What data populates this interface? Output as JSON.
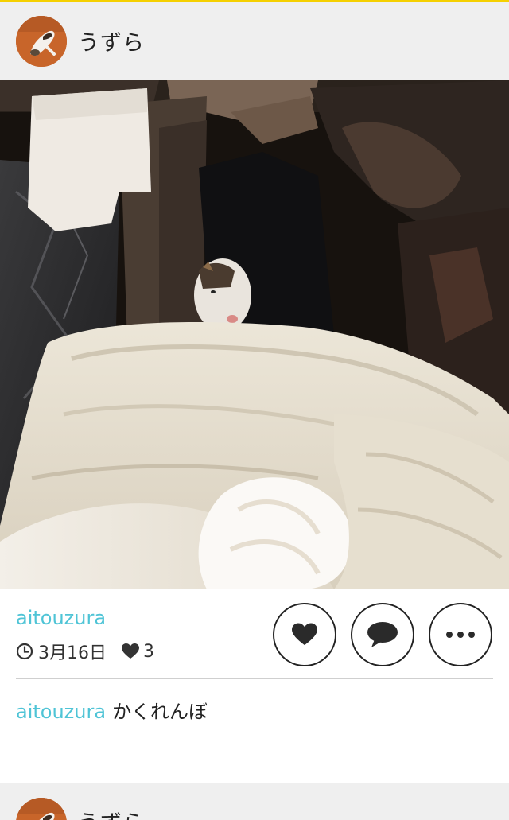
{
  "colors": {
    "accent": "#4fc4d6",
    "top_line": "#f5d000",
    "card_bg": "#ffffff",
    "page_bg": "#efefef"
  },
  "post": {
    "header": {
      "title": "うずら",
      "avatar_icon": "cat-avatar"
    },
    "photo": {
      "icon": "cat-hiding-in-closet-photo"
    },
    "username": "aitouzura",
    "date": "3月16日",
    "like_count": "3",
    "actions": {
      "like_icon": "heart-icon",
      "comment_icon": "speech-bubble-icon",
      "more_icon": "ellipsis-icon"
    },
    "caption": {
      "user": "aitouzura",
      "text": "かくれんぼ"
    }
  },
  "next_post": {
    "header": {
      "title": "うずら"
    }
  }
}
